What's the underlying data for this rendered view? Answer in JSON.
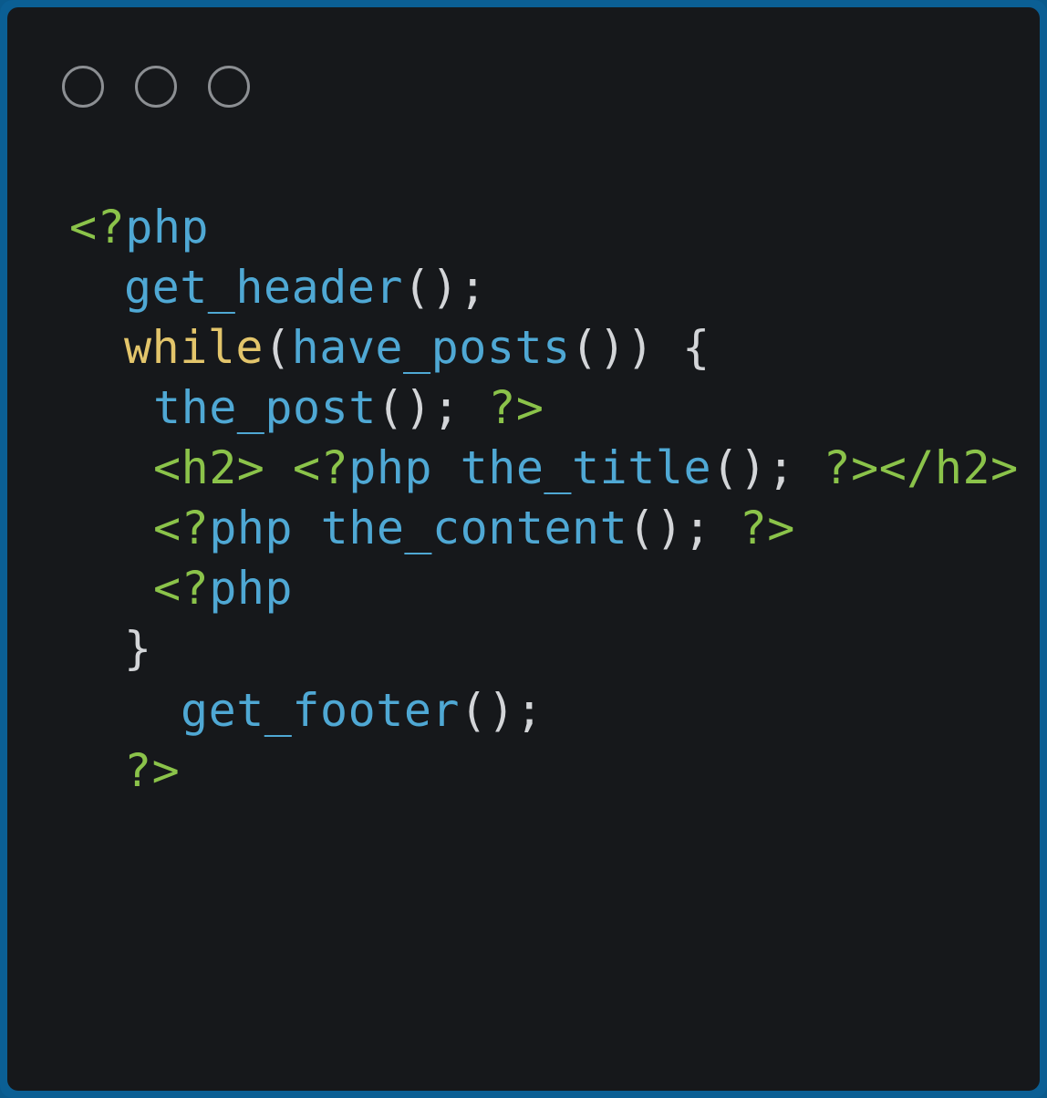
{
  "window": {
    "controls": [
      "window-control-1",
      "window-control-2",
      "window-control-3"
    ]
  },
  "code": {
    "lines": [
      [
        {
          "t": "<?",
          "c": "tag"
        },
        {
          "t": "php",
          "c": "fn"
        }
      ],
      [
        {
          "t": "get_header",
          "c": "fn"
        },
        {
          "t": "();",
          "c": "pun"
        }
      ],
      [
        {
          "t": "while",
          "c": "kw"
        },
        {
          "t": "(",
          "c": "pun"
        },
        {
          "t": "have_posts",
          "c": "fn"
        },
        {
          "t": "()) {",
          "c": "pun"
        }
      ],
      [
        {
          "t": "the_post",
          "c": "fn"
        },
        {
          "t": "(); ",
          "c": "pun"
        },
        {
          "t": "?>",
          "c": "tag"
        }
      ],
      [
        {
          "t": "<h2> <?",
          "c": "tag"
        },
        {
          "t": "php the_title",
          "c": "fn"
        },
        {
          "t": "(); ",
          "c": "pun"
        },
        {
          "t": "?></h2>",
          "c": "tag"
        }
      ],
      [
        {
          "t": "<?",
          "c": "tag"
        },
        {
          "t": "php the_content",
          "c": "fn"
        },
        {
          "t": "(); ",
          "c": "pun"
        },
        {
          "t": "?>",
          "c": "tag"
        }
      ],
      [
        {
          "t": "<?",
          "c": "tag"
        },
        {
          "t": "php",
          "c": "fn"
        }
      ],
      [
        {
          "t": "}",
          "c": "pun"
        }
      ],
      [
        {
          "t": "get_footer",
          "c": "fn"
        },
        {
          "t": "();",
          "c": "pun"
        }
      ],
      [
        {
          "t": "?>",
          "c": "tag"
        }
      ]
    ]
  },
  "colors": {
    "background": "#16181b",
    "border": "#0b5f94",
    "tag": "#8bc34a",
    "function": "#4fa8d4",
    "keyword": "#e3c56b",
    "punctuation": "#d3d5d8"
  }
}
